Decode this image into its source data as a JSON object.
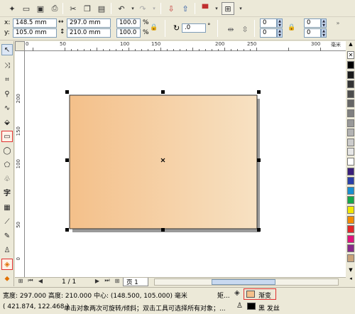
{
  "toolbar": {
    "buttons": [
      "new-icon",
      "open-icon",
      "save-icon",
      "print-icon",
      "cut-icon",
      "copy-icon",
      "paste-icon",
      "undo-icon",
      "redo-icon",
      "import-icon",
      "export-icon",
      "launcher-icon",
      "zoom-icon"
    ]
  },
  "property_bar": {
    "x_label": "x:",
    "x_value": "148.5 mm",
    "y_label": "y:",
    "y_value": "105.0 mm",
    "width_value": "297.0 mm",
    "height_value": "210.0 mm",
    "scale_x": "100.0",
    "scale_y": "100.0",
    "percent": "%",
    "rotation": ".0",
    "corner_tl": "0",
    "corner_bl": "0",
    "corner_tr": "0",
    "corner_br": "0"
  },
  "ruler": {
    "top_ticks": [
      "0",
      "50",
      "100",
      "150",
      "200",
      "250",
      "300"
    ],
    "unit": "毫米",
    "left_ticks": [
      "200",
      "150",
      "100",
      "50",
      "0"
    ]
  },
  "canvas": {
    "gradient_start": "#f4c08a",
    "gradient_end": "#f7e1c2"
  },
  "palette": {
    "colors": [
      "#000000",
      "#1a1a1a",
      "#333333",
      "#4d4d4d",
      "#666666",
      "#808080",
      "#999999",
      "#b3b3b3",
      "#cccccc",
      "#e6e6e6",
      "#ffffff",
      "#3a1f7a",
      "#2b3fa8",
      "#1a8fd0",
      "#17a84a",
      "#f2e600",
      "#f28c00",
      "#e3262b",
      "#e0137b",
      "#8a2a8a",
      "#c9a37a"
    ]
  },
  "pagebar": {
    "page_count": "1 / 1",
    "page_tab": "页 1"
  },
  "status": {
    "line1": "宽度: 297.000  高度: 210.000  中心: (148.500, 105.000)  毫米",
    "obj_label": "矩...",
    "fill_label": "渐变",
    "coords": "( 421.874, 122.468 )",
    "hint": "单击对象两次可旋转/倾斜；双击工具可选择所有对象；...",
    "outline_label": "黑 发丝"
  }
}
